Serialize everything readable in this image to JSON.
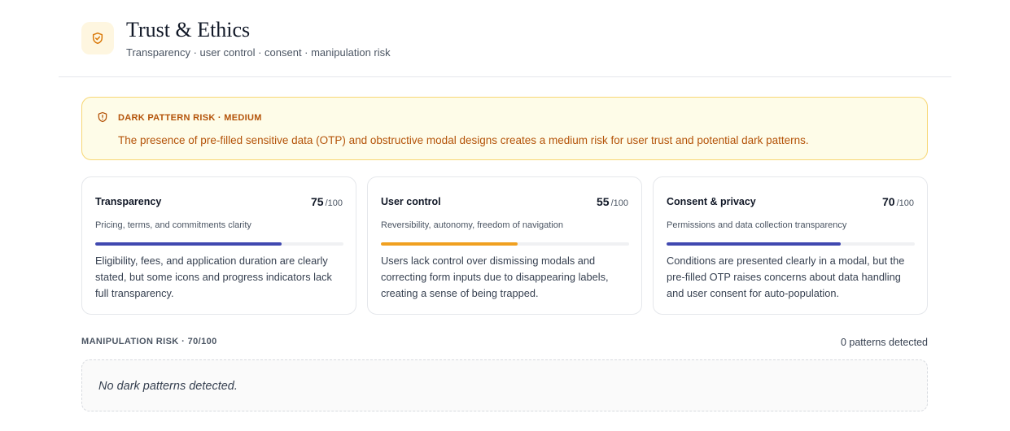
{
  "header": {
    "icon": "shield-check-icon",
    "title": "Trust & Ethics",
    "subtitle": "Transparency · user control · consent · manipulation risk"
  },
  "alert": {
    "icon": "shield-alert-icon",
    "title": "DARK PATTERN RISK · MEDIUM",
    "message": "The presence of pre-filled sensitive data (OTP) and obstructive modal designs creates a medium risk for user trust and potential dark patterns.",
    "color": "#b45309"
  },
  "cards": [
    {
      "title": "Transparency",
      "score": "75",
      "max": "/100",
      "fraction": 0.75,
      "subtitle": "Pricing, terms, and commitments clarity",
      "description": "Eligibility, fees, and application duration are clearly stated, but some icons and progress indicators lack full transparency.",
      "color": "#4048b0"
    },
    {
      "title": "User control",
      "score": "55",
      "max": "/100",
      "fraction": 0.55,
      "subtitle": "Reversibility, autonomy, freedom of navigation",
      "description": "Users lack control over dismissing modals and correcting form inputs due to disappearing labels, creating a sense of being trapped.",
      "color": "#f0a020"
    },
    {
      "title": "Consent & privacy",
      "score": "70",
      "max": "/100",
      "fraction": 0.7,
      "subtitle": "Permissions and data collection transparency",
      "description": "Conditions are presented clearly in a modal, but the pre-filled OTP raises concerns about data handling and user consent for auto-population.",
      "color": "#4048b0"
    }
  ],
  "manipulation": {
    "label": "MANIPULATION RISK · 70/100",
    "count": "0 patterns detected",
    "empty_message": "No dark patterns detected."
  }
}
